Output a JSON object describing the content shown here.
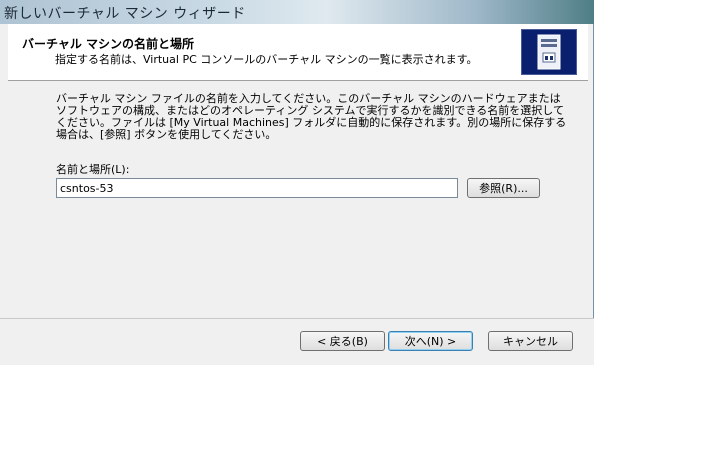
{
  "window": {
    "title": "新しいバーチャル マシン ウィザード"
  },
  "header": {
    "title": "バーチャル マシンの名前と場所",
    "subtitle": "指定する名前は、Virtual PC コンソールのバーチャル マシンの一覧に表示されます。",
    "icon": "virtual-machine-icon"
  },
  "main": {
    "description": "バーチャル マシン ファイルの名前を入力してください。このバーチャル マシンのハードウェアまたはソフトウェアの構成、またはどのオペレーティング システムで実行するかを識別できる名前を選択してください。ファイルは [My Virtual Machines] フォルダに自動的に保存されます。別の場所に保存する場合は、[参照] ボタンを使用してください。",
    "field_label": "名前と場所(L):",
    "name_value": "csntos-53",
    "browse_label": "参照(R)..."
  },
  "footer": {
    "back_label": "< 戻る(B)",
    "next_label": "次へ(N) >",
    "cancel_label": "キャンセル"
  }
}
